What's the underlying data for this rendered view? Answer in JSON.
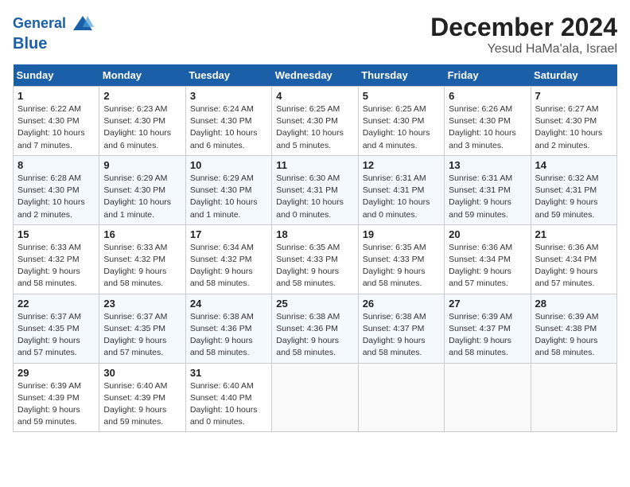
{
  "header": {
    "logo_line1": "General",
    "logo_line2": "Blue",
    "month": "December 2024",
    "location": "Yesud HaMa'ala, Israel"
  },
  "weekdays": [
    "Sunday",
    "Monday",
    "Tuesday",
    "Wednesday",
    "Thursday",
    "Friday",
    "Saturday"
  ],
  "weeks": [
    [
      {
        "day": "1",
        "info": "Sunrise: 6:22 AM\nSunset: 4:30 PM\nDaylight: 10 hours\nand 7 minutes."
      },
      {
        "day": "2",
        "info": "Sunrise: 6:23 AM\nSunset: 4:30 PM\nDaylight: 10 hours\nand 6 minutes."
      },
      {
        "day": "3",
        "info": "Sunrise: 6:24 AM\nSunset: 4:30 PM\nDaylight: 10 hours\nand 6 minutes."
      },
      {
        "day": "4",
        "info": "Sunrise: 6:25 AM\nSunset: 4:30 PM\nDaylight: 10 hours\nand 5 minutes."
      },
      {
        "day": "5",
        "info": "Sunrise: 6:25 AM\nSunset: 4:30 PM\nDaylight: 10 hours\nand 4 minutes."
      },
      {
        "day": "6",
        "info": "Sunrise: 6:26 AM\nSunset: 4:30 PM\nDaylight: 10 hours\nand 3 minutes."
      },
      {
        "day": "7",
        "info": "Sunrise: 6:27 AM\nSunset: 4:30 PM\nDaylight: 10 hours\nand 2 minutes."
      }
    ],
    [
      {
        "day": "8",
        "info": "Sunrise: 6:28 AM\nSunset: 4:30 PM\nDaylight: 10 hours\nand 2 minutes."
      },
      {
        "day": "9",
        "info": "Sunrise: 6:29 AM\nSunset: 4:30 PM\nDaylight: 10 hours\nand 1 minute."
      },
      {
        "day": "10",
        "info": "Sunrise: 6:29 AM\nSunset: 4:30 PM\nDaylight: 10 hours\nand 1 minute."
      },
      {
        "day": "11",
        "info": "Sunrise: 6:30 AM\nSunset: 4:31 PM\nDaylight: 10 hours\nand 0 minutes."
      },
      {
        "day": "12",
        "info": "Sunrise: 6:31 AM\nSunset: 4:31 PM\nDaylight: 10 hours\nand 0 minutes."
      },
      {
        "day": "13",
        "info": "Sunrise: 6:31 AM\nSunset: 4:31 PM\nDaylight: 9 hours\nand 59 minutes."
      },
      {
        "day": "14",
        "info": "Sunrise: 6:32 AM\nSunset: 4:31 PM\nDaylight: 9 hours\nand 59 minutes."
      }
    ],
    [
      {
        "day": "15",
        "info": "Sunrise: 6:33 AM\nSunset: 4:32 PM\nDaylight: 9 hours\nand 58 minutes."
      },
      {
        "day": "16",
        "info": "Sunrise: 6:33 AM\nSunset: 4:32 PM\nDaylight: 9 hours\nand 58 minutes."
      },
      {
        "day": "17",
        "info": "Sunrise: 6:34 AM\nSunset: 4:32 PM\nDaylight: 9 hours\nand 58 minutes."
      },
      {
        "day": "18",
        "info": "Sunrise: 6:35 AM\nSunset: 4:33 PM\nDaylight: 9 hours\nand 58 minutes."
      },
      {
        "day": "19",
        "info": "Sunrise: 6:35 AM\nSunset: 4:33 PM\nDaylight: 9 hours\nand 58 minutes."
      },
      {
        "day": "20",
        "info": "Sunrise: 6:36 AM\nSunset: 4:34 PM\nDaylight: 9 hours\nand 57 minutes."
      },
      {
        "day": "21",
        "info": "Sunrise: 6:36 AM\nSunset: 4:34 PM\nDaylight: 9 hours\nand 57 minutes."
      }
    ],
    [
      {
        "day": "22",
        "info": "Sunrise: 6:37 AM\nSunset: 4:35 PM\nDaylight: 9 hours\nand 57 minutes."
      },
      {
        "day": "23",
        "info": "Sunrise: 6:37 AM\nSunset: 4:35 PM\nDaylight: 9 hours\nand 57 minutes."
      },
      {
        "day": "24",
        "info": "Sunrise: 6:38 AM\nSunset: 4:36 PM\nDaylight: 9 hours\nand 58 minutes."
      },
      {
        "day": "25",
        "info": "Sunrise: 6:38 AM\nSunset: 4:36 PM\nDaylight: 9 hours\nand 58 minutes."
      },
      {
        "day": "26",
        "info": "Sunrise: 6:38 AM\nSunset: 4:37 PM\nDaylight: 9 hours\nand 58 minutes."
      },
      {
        "day": "27",
        "info": "Sunrise: 6:39 AM\nSunset: 4:37 PM\nDaylight: 9 hours\nand 58 minutes."
      },
      {
        "day": "28",
        "info": "Sunrise: 6:39 AM\nSunset: 4:38 PM\nDaylight: 9 hours\nand 58 minutes."
      }
    ],
    [
      {
        "day": "29",
        "info": "Sunrise: 6:39 AM\nSunset: 4:39 PM\nDaylight: 9 hours\nand 59 minutes."
      },
      {
        "day": "30",
        "info": "Sunrise: 6:40 AM\nSunset: 4:39 PM\nDaylight: 9 hours\nand 59 minutes."
      },
      {
        "day": "31",
        "info": "Sunrise: 6:40 AM\nSunset: 4:40 PM\nDaylight: 10 hours\nand 0 minutes."
      },
      {
        "day": "",
        "info": ""
      },
      {
        "day": "",
        "info": ""
      },
      {
        "day": "",
        "info": ""
      },
      {
        "day": "",
        "info": ""
      }
    ]
  ]
}
